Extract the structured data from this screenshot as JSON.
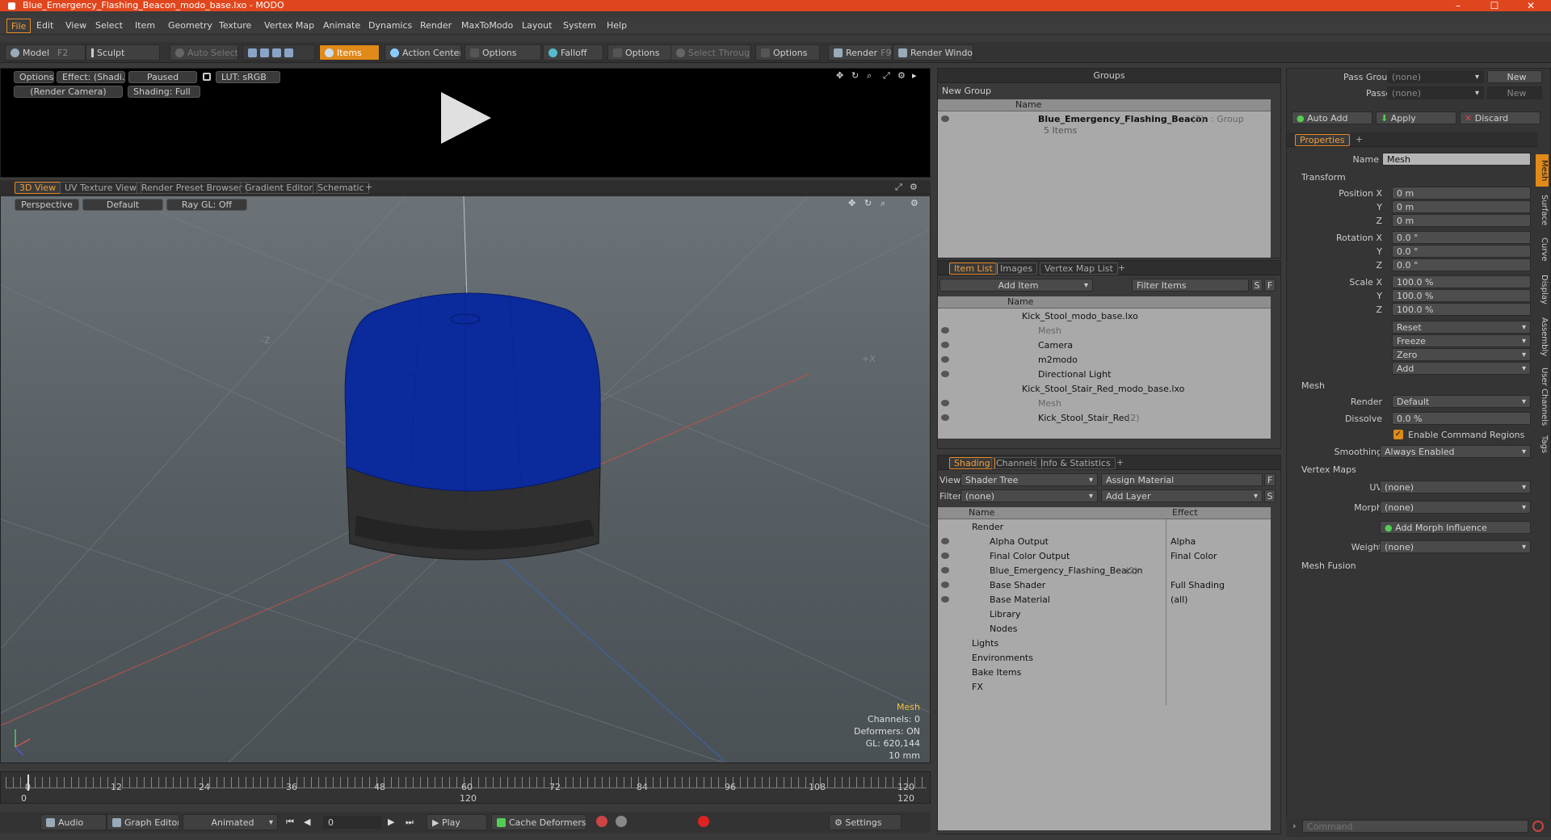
{
  "window": {
    "title": "Blue_Emergency_Flashing_Beacon_modo_base.lxo - MODO"
  },
  "menu": [
    "File",
    "Edit",
    "View",
    "Select",
    "Item",
    "Geometry",
    "Texture",
    "Vertex Map",
    "Animate",
    "Dynamics",
    "Render",
    "MaxToModo",
    "Layout",
    "System",
    "Help"
  ],
  "toolbar": {
    "model": "Model",
    "model_key": "F2",
    "sculpt": "Sculpt",
    "auto_select": "Auto Select",
    "items": "Items",
    "action_center": "Action Center",
    "options1": "Options",
    "falloff": "Falloff",
    "options2": "Options",
    "select_through": "Select Through",
    "options3": "Options",
    "render": "Render",
    "render_key": "F9",
    "render_window": "Render Window"
  },
  "render_preview": {
    "options": "Options",
    "effect": "Effect: (Shadi...",
    "paused": "Paused",
    "lut": "LUT: sRGB",
    "camera": "(Render Camera)",
    "shading": "Shading: Full"
  },
  "view_tabs": [
    "3D View",
    "UV Texture View",
    "Render Preset Browser",
    "Gradient Editor",
    "Schematic",
    "+"
  ],
  "viewport": {
    "perspective": "Perspective",
    "default": "Default",
    "raygl": "Ray GL: Off",
    "axis_minus_z": "-Z",
    "axis_plus_x": "+X",
    "info": {
      "mesh": "Mesh",
      "channels": "Channels: 0",
      "deformers": "Deformers: ON",
      "gl": "GL: 620,144",
      "units": "10 mm"
    },
    "beacon_color": "#0b2a9c"
  },
  "timeline": {
    "ticks": [
      "0",
      "12",
      "24",
      "36",
      "48",
      "60",
      "72",
      "84",
      "96",
      "108",
      "120"
    ],
    "lower_left": "0",
    "lower_mid": "120",
    "lower_right": "120"
  },
  "transport": {
    "audio": "Audio",
    "graph_editor": "Graph Editor",
    "animated": "Animated",
    "frame": "0",
    "play": "Play",
    "cache": "Cache Deformers",
    "settings": "Settings"
  },
  "groups": {
    "title": "Groups",
    "new_group": "New Group",
    "col_name": "Name",
    "item_name": "Blue_Emergency_Flashing_Beacon",
    "item_count": "(3)",
    "item_type": ": Group",
    "item_sub": "5 Items"
  },
  "item_list": {
    "tabs": [
      "Item List",
      "Images",
      "Vertex Map List",
      "+"
    ],
    "add_item": "Add Item",
    "filter": "Filter Items",
    "s": "S",
    "f": "F",
    "col_name": "Name",
    "rows": [
      {
        "name": "Kick_Stool_modo_base.lxo",
        "indent": 0,
        "dim": false
      },
      {
        "name": "Mesh",
        "indent": 1,
        "dim": true
      },
      {
        "name": "Camera",
        "indent": 1,
        "dim": false
      },
      {
        "name": "m2modo",
        "indent": 1,
        "dim": false
      },
      {
        "name": "Directional Light",
        "indent": 1,
        "dim": false
      },
      {
        "name": "Kick_Stool_Stair_Red_modo_base.lxo",
        "indent": 0,
        "dim": false
      },
      {
        "name": "Mesh",
        "indent": 1,
        "dim": true
      },
      {
        "name": "Kick_Stool_Stair_Red",
        "indent": 1,
        "dim": false,
        "extra": "(2)"
      }
    ]
  },
  "shading": {
    "tabs": [
      "Shading",
      "Channels",
      "Info & Statistics",
      "+"
    ],
    "view_label": "View",
    "view_value": "Shader Tree",
    "assign": "Assign Material",
    "f": "F",
    "filter_label": "Filter",
    "filter_value": "(none)",
    "add_layer": "Add Layer",
    "s": "S",
    "col_name": "Name",
    "col_effect": "Effect",
    "rows": [
      {
        "name": "Render",
        "effect": "",
        "indent": 0
      },
      {
        "name": "Alpha Output",
        "effect": "Alpha",
        "indent": 1
      },
      {
        "name": "Final Color Output",
        "effect": "Final Color",
        "indent": 1
      },
      {
        "name": "Blue_Emergency_Flashing_Beacon",
        "effect": "",
        "indent": 1,
        "extra": "(2)"
      },
      {
        "name": "Base Shader",
        "effect": "Full Shading",
        "indent": 1
      },
      {
        "name": "Base Material",
        "effect": "(all)",
        "indent": 1
      },
      {
        "name": "Library",
        "effect": "",
        "indent": 1
      },
      {
        "name": "Nodes",
        "effect": "",
        "indent": 1
      },
      {
        "name": "Lights",
        "effect": "",
        "indent": 0
      },
      {
        "name": "Environments",
        "effect": "",
        "indent": 0
      },
      {
        "name": "Bake Items",
        "effect": "",
        "indent": 0
      },
      {
        "name": "FX",
        "effect": "",
        "indent": 0
      }
    ]
  },
  "passes": {
    "pass_groups": "Pass Groups",
    "pass_groups_value": "(none)",
    "passes": "Passes",
    "passes_value": "(none)",
    "new": "New",
    "new2": "New"
  },
  "actions": {
    "auto_add": "Auto Add",
    "apply": "Apply",
    "discard": "Discard"
  },
  "properties": {
    "tab": "Properties",
    "plus": "+",
    "name_label": "Name",
    "name_value": "Mesh",
    "transform": "Transform",
    "pos_x_l": "Position X",
    "pos_x": "0 m",
    "pos_y_l": "Y",
    "pos_y": "0 m",
    "pos_z_l": "Z",
    "pos_z": "0 m",
    "rot_x_l": "Rotation X",
    "rot_x": "0.0 °",
    "rot_y_l": "Y",
    "rot_y": "0.0 °",
    "rot_z_l": "Z",
    "rot_z": "0.0 °",
    "scl_x_l": "Scale X",
    "scl_x": "100.0 %",
    "scl_y_l": "Y",
    "scl_y": "100.0 %",
    "scl_z_l": "Z",
    "scl_z": "100.0 %",
    "reset": "Reset",
    "freeze": "Freeze",
    "zero": "Zero",
    "add": "Add",
    "mesh": "Mesh",
    "render_l": "Render",
    "render_v": "Default",
    "dissolve_l": "Dissolve",
    "dissolve_v": "0.0 %",
    "enable_cmd": "Enable Command Regions",
    "smoothing_l": "Smoothing",
    "smoothing_v": "Always Enabled",
    "vertex_maps": "Vertex Maps",
    "uv_l": "UV",
    "uv_v": "(none)",
    "morph_l": "Morph",
    "morph_v": "(none)",
    "add_morph": "Add Morph Influence",
    "weight_l": "Weight",
    "weight_v": "(none)",
    "mesh_fusion": "Mesh Fusion",
    "side_tabs": [
      "Mesh",
      "Surface",
      "Curve",
      "Display",
      "Assembly",
      "User Channels",
      "Tags"
    ]
  },
  "command": {
    "placeholder": "Command"
  }
}
